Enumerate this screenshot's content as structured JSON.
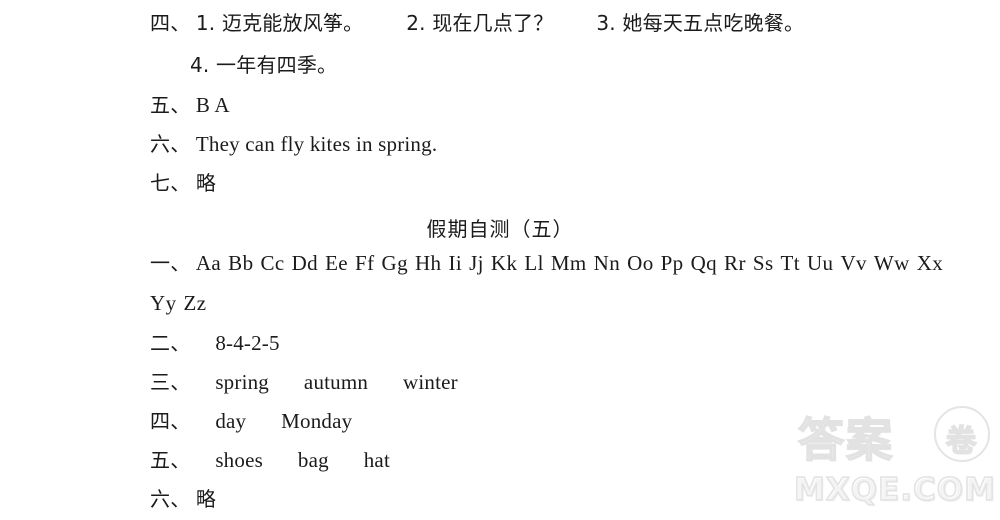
{
  "document": {
    "type": "answer-key-page",
    "background_color": "#ffffff",
    "text_color": "#1b1b1b"
  },
  "previous_section": {
    "items": [
      {
        "marker": "四、",
        "parts": [
          "1. 迈克能放风筝。",
          "2. 现在几点了？",
          "3. 她每天五点吃晚餐。"
        ],
        "continuation": "4. 一年有四季。"
      },
      {
        "marker": "五、",
        "text": "B A"
      },
      {
        "marker": "六、",
        "text": "They can fly kites in spring."
      },
      {
        "marker": "七、",
        "text": "略"
      }
    ]
  },
  "section_title": "假期自测（五）",
  "current_section": {
    "items": [
      {
        "marker": "一、",
        "alphabet": [
          "Aa",
          "Bb",
          "Cc",
          "Dd",
          "Ee",
          "Ff",
          "Gg",
          "Hh",
          "Ii",
          "Jj",
          "Kk",
          "Ll",
          "Mm",
          "Nn",
          "Oo",
          "Pp",
          "Qq",
          "Rr",
          "Ss",
          "Tt",
          "Uu",
          "Vv",
          "Ww",
          "Xx"
        ],
        "alphabet_wrap": [
          "Yy",
          "Zz"
        ]
      },
      {
        "marker": "二、",
        "text": "8-4-2-5"
      },
      {
        "marker": "三、",
        "words": [
          "spring",
          "autumn",
          "winter"
        ]
      },
      {
        "marker": "四、",
        "words": [
          "day",
          "Monday"
        ]
      },
      {
        "marker": "五、",
        "words": [
          "shoes",
          "bag",
          "hat"
        ]
      },
      {
        "marker": "六、",
        "text": "略"
      }
    ]
  },
  "watermark": {
    "cjk_text": "答案",
    "circled_char": "卷",
    "domain": "MXQE.COM"
  }
}
